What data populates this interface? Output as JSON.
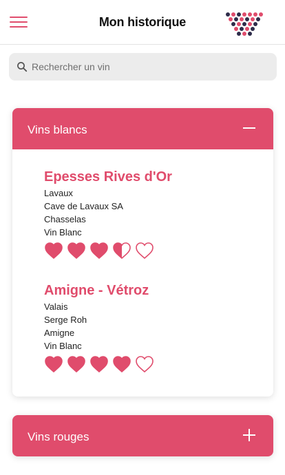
{
  "header": {
    "title": "Mon historique",
    "menu_icon": "hamburger-menu-icon",
    "logo": "dots-logo",
    "accent_color": "#e04c6c",
    "logo_dark_color": "#2e2c4a"
  },
  "search": {
    "placeholder": "Rechercher un vin",
    "value": "",
    "icon": "search-icon"
  },
  "sections": [
    {
      "title": "Vins blancs",
      "expanded": true,
      "toggle_icon": "minus-icon",
      "wines": [
        {
          "name": "Epesses Rives d'Or",
          "region": "Lavaux",
          "producer": "Cave de Lavaux SA",
          "grape": "Chasselas",
          "type": "Vin Blanc",
          "rating": 3.5,
          "rating_max": 5
        },
        {
          "name": "Amigne - Vétroz",
          "region": "Valais",
          "producer": "Serge Roh",
          "grape": "Amigne",
          "type": "Vin Blanc",
          "rating": 4,
          "rating_max": 5
        }
      ]
    },
    {
      "title": "Vins rouges",
      "expanded": false,
      "toggle_icon": "plus-icon",
      "wines": []
    }
  ]
}
